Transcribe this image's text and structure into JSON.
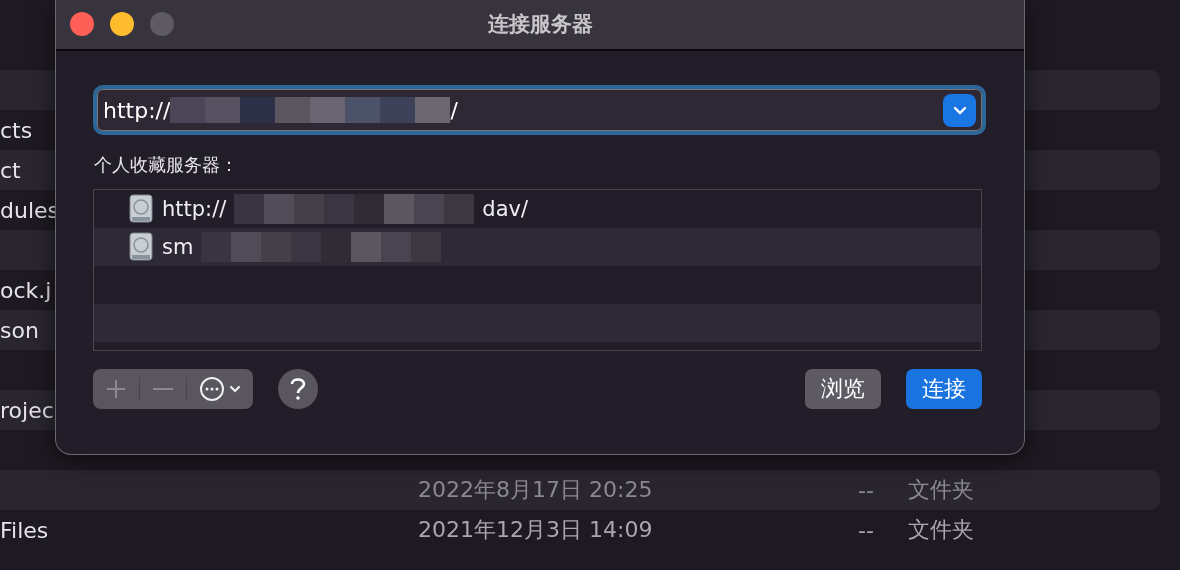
{
  "background_rows": [
    {},
    {},
    {
      "name": "cts"
    },
    {
      "name": "ct"
    },
    {
      "name": "dules"
    },
    {},
    {
      "name": "ock.j"
    },
    {
      "name": "son"
    },
    {},
    {
      "name": "rojec"
    },
    {},
    {
      "date": "2022年8月17日 20:25",
      "size": "--",
      "kind": "文件夹",
      "dim": true
    },
    {
      "name": "Files",
      "date": "2021年12月3日 14:09",
      "size": "--",
      "kind": "文件夹",
      "dim": false
    }
  ],
  "dialog": {
    "title": "连接服务器",
    "address": {
      "value_start": "http://",
      "value_end": "/"
    },
    "favorites_label": "个人收藏服务器：",
    "favorites": [
      {
        "start": "http://",
        "end": "dav/"
      },
      {
        "start": "sm"
      }
    ],
    "buttons": [
      {
        "label": "浏览",
        "kind": "secondary"
      },
      {
        "label": "连接",
        "kind": "primary"
      }
    ]
  }
}
